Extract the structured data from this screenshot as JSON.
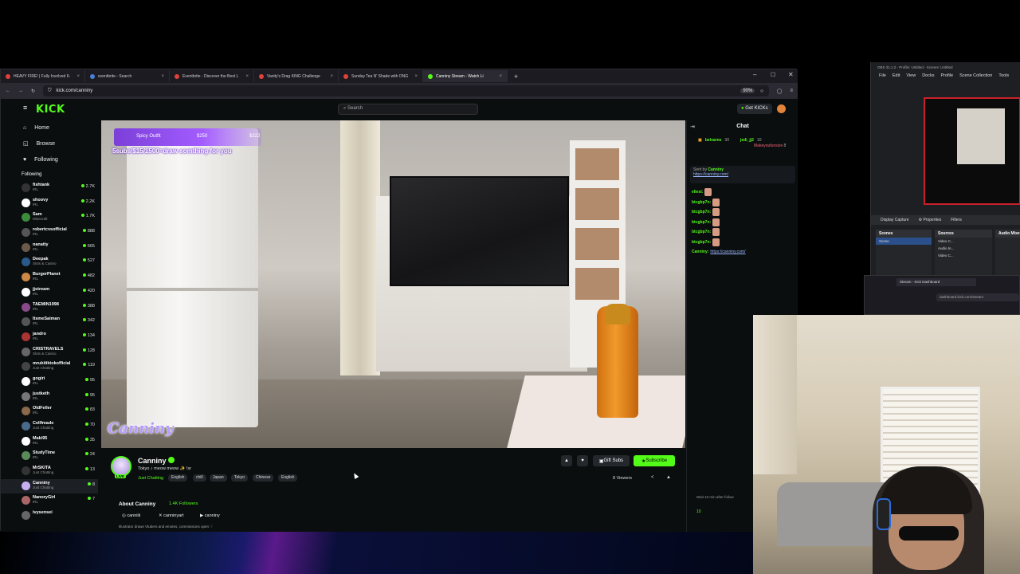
{
  "browser": {
    "tabs": [
      {
        "label": "HEAVY FIRE! | Fully Involved 6-",
        "color": "#e0413a"
      },
      {
        "label": "eventbrite - Search",
        "color": "#4a7fd8"
      },
      {
        "label": "Eventbrite - Discover the Best L",
        "color": "#e0413a"
      },
      {
        "label": "Vanity's Drag KING Challenge",
        "color": "#e0413a"
      },
      {
        "label": "Sunday Tea N' Shade with ONG",
        "color": "#e0413a"
      },
      {
        "label": "Canniny Stream - Watch Li",
        "color": "#53fc18",
        "active": true
      }
    ],
    "url": "kick.com/canniny",
    "zoom": "90%"
  },
  "kick": {
    "logo": "KICK",
    "search_placeholder": "Search",
    "get_kicks": "Get KICKs",
    "nav": [
      {
        "label": "Home",
        "icon": "home-icon"
      },
      {
        "label": "Browse",
        "icon": "browse-icon"
      },
      {
        "label": "Following",
        "icon": "heart-icon"
      }
    ],
    "following_title": "Following",
    "following": [
      {
        "name": "fishtank",
        "cat": "IRL",
        "viewers": "2.7K",
        "color": "#333"
      },
      {
        "name": "shoovy",
        "cat": "IRL",
        "viewers": "2.2K",
        "color": "#fff"
      },
      {
        "name": "Sam",
        "cat": "Minecraft",
        "viewers": "1.7K",
        "color": "#3c8c3c"
      },
      {
        "name": "robertcvsofficial",
        "cat": "IRL",
        "viewers": "888",
        "color": "#555"
      },
      {
        "name": "nanatty",
        "cat": "IRL",
        "viewers": "665",
        "color": "#6b5a4a"
      },
      {
        "name": "Deepak",
        "cat": "Slots & Casino",
        "viewers": "527",
        "color": "#2a5a8a"
      },
      {
        "name": "BurgerPlanet",
        "cat": "IRL",
        "viewers": "482",
        "color": "#c84"
      },
      {
        "name": "jjstream",
        "cat": "IRL",
        "viewers": "420",
        "color": "#fff"
      },
      {
        "name": "TAEMIN1998",
        "cat": "IRL",
        "viewers": "388",
        "color": "#8a4a8a"
      },
      {
        "name": "ItsmeSaiman",
        "cat": "IRL",
        "viewers": "342",
        "color": "#555"
      },
      {
        "name": "jandro",
        "cat": "IRL",
        "viewers": "134",
        "color": "#a33"
      },
      {
        "name": "CRISTRAVELS",
        "cat": "Slots & Casino",
        "viewers": "128",
        "color": "#666"
      },
      {
        "name": "mrukitiktokofficial",
        "cat": "Just Chatting",
        "viewers": "119",
        "color": "#444"
      },
      {
        "name": "gogiri",
        "cat": "IRL",
        "viewers": "95",
        "color": "#fff"
      },
      {
        "name": "justketh",
        "cat": "IRL",
        "viewers": "95",
        "color": "#777"
      },
      {
        "name": "OldFeller",
        "cat": "IRL",
        "viewers": "83",
        "color": "#8a6a4a"
      },
      {
        "name": "Cellfmade",
        "cat": "Just Chatting",
        "viewers": "70",
        "color": "#4a6a8a"
      },
      {
        "name": "Maki95",
        "cat": "IRL",
        "viewers": "35",
        "color": "#fff"
      },
      {
        "name": "StudyTime",
        "cat": "IRL",
        "viewers": "24",
        "color": "#5a8a5a"
      },
      {
        "name": "MrSKITA",
        "cat": "Just Chatting",
        "viewers": "13",
        "color": "#333"
      },
      {
        "name": "Canniny",
        "cat": "Just Chatting",
        "viewers": "8",
        "color": "#c8b0f0",
        "selected": true
      },
      {
        "name": "NanoryGirl",
        "cat": "IRL",
        "viewers": "7",
        "color": "#a66"
      },
      {
        "name": "ivysensei",
        "cat": "",
        "viewers": "",
        "color": "#666"
      }
    ],
    "overlay": {
      "goal_label": "Spicy Outfit",
      "goal_current": "$250",
      "goal_target": "$222",
      "goal_text": "5subs/$15/1500=draw somthing for you",
      "watermark": "Canniny"
    },
    "chat": {
      "title": "Chat",
      "top_gifters": [
        {
          "name": "belvarns",
          "amount": "30"
        },
        {
          "name": "jedi_jj2",
          "amount": "10"
        },
        {
          "name": "Makeyoufunsize",
          "amount": "8"
        }
      ],
      "pinned_by": "Sent by",
      "pinned_user": "Canniny",
      "pinned_link": "https://canniny.com/",
      "messages": [
        {
          "user": "eliest:",
          "text": ""
        },
        {
          "user": "btcgbp7n:",
          "text": ""
        },
        {
          "user": "btcgbp7n:",
          "text": ""
        },
        {
          "user": "btcgbp7n:",
          "text": ""
        },
        {
          "user": "btcgbp7n:",
          "text": ""
        },
        {
          "user": "btcgbp7n:",
          "text": ""
        },
        {
          "user": "Canniny:",
          "text": "https://canniny.com/"
        }
      ],
      "slow_mode": "Wait 10 min after follow",
      "kicks": "10"
    },
    "streamer": {
      "name": "Canniny",
      "title": "Tokyo ♪ meow meow ✨ !sr",
      "category": "Just Chatting",
      "tags": [
        "English",
        "chill",
        "Japan",
        "Tokyo",
        "Chinese",
        "English"
      ],
      "gift_subs": "Gift Subs",
      "subscribe": "Subscribe",
      "viewers": "8 Viewers",
      "live": "LIVE",
      "about": "About Canniny",
      "followers": "1.4K Followers",
      "socials": [
        "canniiii",
        "canninyart",
        "canniny"
      ],
      "bio": "Illustrator draws Vtubers and emotes, commissions open ♡"
    }
  },
  "obs": {
    "title": "OBS 31.1.2 - Profile: Untitled - Scenes: Untitled",
    "menu": [
      "File",
      "Edit",
      "View",
      "Docks",
      "Profile",
      "Scene Collection",
      "Tools"
    ],
    "capture_label": "Display Capture",
    "properties": "Properties",
    "filters": "Filters",
    "scenes_title": "Scenes",
    "scene_item": "Scene",
    "sources_title": "Sources",
    "sources": [
      "Video C...",
      "Audio In...",
      "Video C..."
    ],
    "mixer_title": "Audio Mixe"
  },
  "dashboard": {
    "tab": "Stream - Kick Dashboard",
    "url": "dashboard.kick.com/stream"
  }
}
